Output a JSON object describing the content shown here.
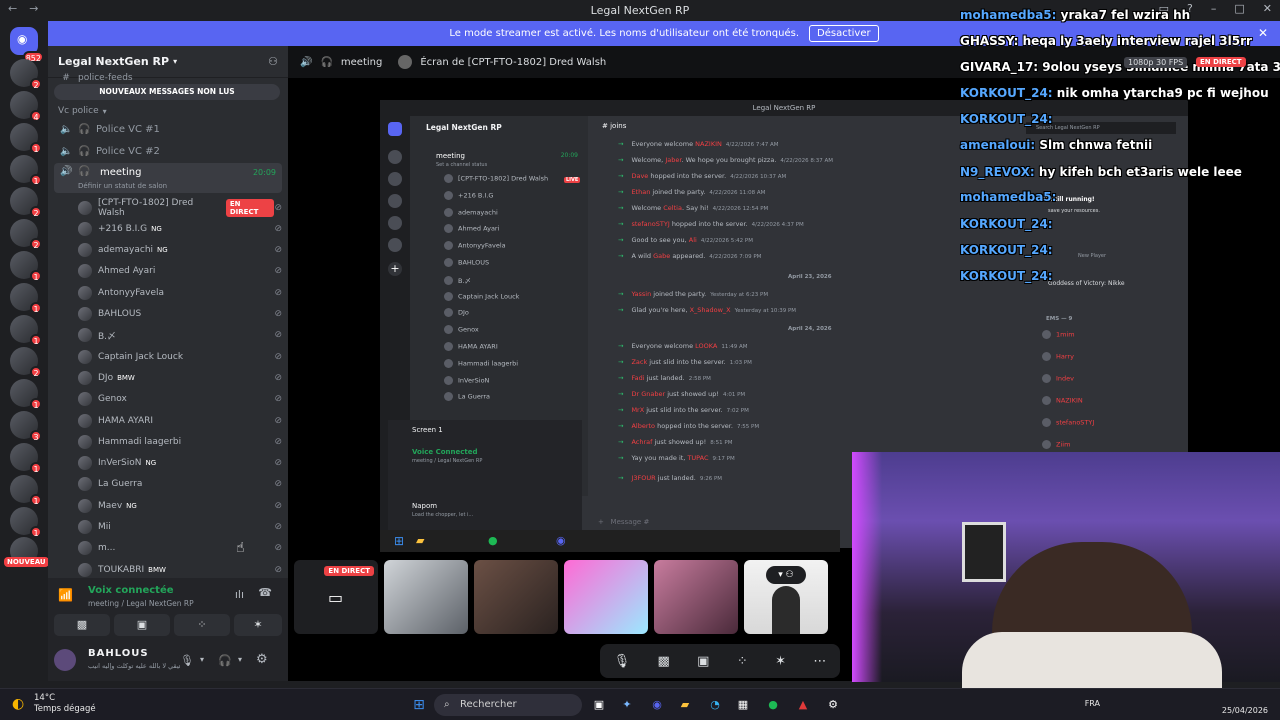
{
  "window": {
    "title": "Legal NextGen RP"
  },
  "banner": {
    "text": "Le mode streamer est activé. Les noms d'utilisateur ont été tronqués.",
    "button": "Désactiver"
  },
  "rail": {
    "home_badge": "852",
    "new_badge": "NOUVEAU",
    "badges": [
      "2",
      "4",
      "1",
      "1",
      "2",
      "2",
      "1",
      "1",
      "1",
      "2",
      "1",
      "3",
      "1",
      "1",
      "1",
      "1",
      "1",
      "2"
    ]
  },
  "sidebar": {
    "guild_name": "Legal NextGen RP",
    "partial_channel": "police-feeds",
    "new_messages": "NOUVEAUX MESSAGES NON LUS",
    "category": "Vc police",
    "channels": [
      "Police VC #1",
      "Police VC #2"
    ],
    "active_channel": {
      "name": "meeting",
      "time": "20:09",
      "status": "Définir un statut de salon"
    },
    "members": [
      {
        "name": "[CPT-FTO-1802] Dred Walsh",
        "tag": "",
        "live": "EN DIRECT"
      },
      {
        "name": "+216 B.I.G",
        "tag": "NG"
      },
      {
        "name": "ademayachi",
        "tag": "NG"
      },
      {
        "name": "Ahmed Ayari",
        "tag": ""
      },
      {
        "name": "AntonyyFavela",
        "tag": ""
      },
      {
        "name": "BAHLOUS",
        "tag": ""
      },
      {
        "name": "B.〆",
        "tag": ""
      },
      {
        "name": "Captain Jack Louck",
        "tag": ""
      },
      {
        "name": "DJo",
        "tag": "BMW"
      },
      {
        "name": "Genox",
        "tag": ""
      },
      {
        "name": "HAMA AYARI",
        "tag": ""
      },
      {
        "name": "Hammadi laagerbi",
        "tag": ""
      },
      {
        "name": "InVerSioN",
        "tag": "NG"
      },
      {
        "name": "La Guerra",
        "tag": ""
      },
      {
        "name": "Maev",
        "tag": "NG"
      },
      {
        "name": "Mii",
        "tag": ""
      },
      {
        "name": "m...",
        "tag": ""
      },
      {
        "name": "TOUKABRI",
        "tag": "BMW"
      }
    ],
    "voice": {
      "status": "Voix connectée",
      "location": "meeting / Legal NextGen RP"
    },
    "user": {
      "name": "BAHLOUS",
      "sub": "ربنا توفيقي لا بالله عليه توكلت وإليه انيب"
    }
  },
  "main": {
    "channel": "meeting",
    "screen": "Écran de [CPT-FTO-1802] Dred Walsh",
    "live_label": "EN DIRECT"
  },
  "share": {
    "title": "Legal NextGen RP",
    "guild": "Legal NextGen RP",
    "channel": "joins",
    "meeting": "meeting",
    "meeting_time": "20:09",
    "set_status": "Set a channel status",
    "members": [
      "[CPT-FTO-1802] Dred Walsh",
      "+216 B.I.G",
      "ademayachi",
      "Ahmed Ayari",
      "AntonyyFavela",
      "BAHLOUS",
      "B.〆",
      "Captain Jack Louck",
      "DJo",
      "Genox",
      "HAMA AYARI",
      "Hammadi laagerbi",
      "InVerSioN",
      "La Guerra"
    ],
    "live": "LIVE",
    "screen_label": "Screen 1",
    "voice_connected": "Voice Connected",
    "voice_loc": "meeting / Legal NextGen RP",
    "user": "Napom",
    "user_sub": "Load the chopper, let i...",
    "msg_placeholder": "Message #",
    "date1": "April 23, 2026",
    "date2": "April 24, 2026",
    "messages": [
      {
        "pre": "Everyone welcome ",
        "name": "NAZIKIN",
        "post": "",
        "time": "4/22/2026 7:47 AM"
      },
      {
        "pre": "Welcome, ",
        "name": "Jaber",
        "post": ". We hope you brought pizza.",
        "time": "4/22/2026 8:37 AM"
      },
      {
        "pre": "",
        "name": "Dave",
        "post": " hopped into the server.",
        "time": "4/22/2026 10:37 AM"
      },
      {
        "pre": "",
        "name": "Ethan",
        "post": " joined the party.",
        "time": "4/22/2026 11:08 AM"
      },
      {
        "pre": "Welcome ",
        "name": "Celtia",
        "post": ". Say hi!",
        "time": "4/22/2026 12:54 PM"
      },
      {
        "pre": "",
        "name": "stefanoSTYJ",
        "post": " hopped into the server.",
        "time": "4/22/2026 4:37 PM"
      },
      {
        "pre": "Good to see you, ",
        "name": "Ali",
        "post": "",
        "time": "4/22/2026 5:42 PM"
      },
      {
        "pre": "A wild ",
        "name": "Gabe",
        "post": " appeared.",
        "time": "4/22/2026 7:09 PM"
      },
      {
        "pre": "",
        "name": "Yassin",
        "post": " joined the party.",
        "time": "Yesterday at 6:23 PM"
      },
      {
        "pre": "Glad you're here, ",
        "name": "X_Shadow_X",
        "post": "",
        "time": "Yesterday at 10:39 PM"
      },
      {
        "pre": "Everyone welcome ",
        "name": "LOOKA",
        "post": "",
        "time": "11:49 AM"
      },
      {
        "pre": "",
        "name": "Zack",
        "post": " just slid into the server.",
        "time": "1:03 PM"
      },
      {
        "pre": "",
        "name": "Fadi",
        "post": " just landed.",
        "time": "2:58 PM"
      },
      {
        "pre": "",
        "name": "Dr Gnaber",
        "post": " just showed up!",
        "time": "4:01 PM"
      },
      {
        "pre": "",
        "name": "MrX",
        "post": " just slid into the server.",
        "time": "7:02 PM"
      },
      {
        "pre": "",
        "name": "Alberto",
        "post": " hopped into the server.",
        "time": "7:55 PM"
      },
      {
        "pre": "",
        "name": "Achraf",
        "post": " just showed up!",
        "time": "8:51 PM"
      },
      {
        "pre": "Yay you made it, ",
        "name": "TUPAC",
        "post": "",
        "time": "9:17 PM"
      },
      {
        "pre": "",
        "name": "J3FOUR",
        "post": " just landed.",
        "time": "9:26 PM"
      }
    ],
    "search": "Search Legal NextGen RP",
    "notif1": "Your stream is still running!",
    "notif2": "save your resources.",
    "game": "Goddess of Victory: Nikke",
    "game_sub": "New Player",
    "ems_header": "EMS — 9",
    "right_members": [
      "1mim",
      "Harry",
      "Indev",
      "NAZIKIN",
      "stefanoSTYJ",
      "Ziim"
    ]
  },
  "chat_overlay": [
    {
      "user": "mohamedba5:",
      "msg": "yraka7 fel wzira hh"
    },
    {
      "user": "GHASSY:",
      "msg": "heqa ly 3aely interview rajel 3l5rr"
    },
    {
      "user": "GIVARA_17:",
      "msg": "9olou yseys 3linamee mmna 7ata 3asba"
    },
    {
      "user": "KORKOUT_24:",
      "msg": "nik omha ytarcha9 pc fi wejhou"
    },
    {
      "user": "KORKOUT_24:",
      "msg": ""
    },
    {
      "user": "amenaloui:",
      "msg": "Slm chnwa fetnii"
    },
    {
      "user": "N9_REVOX:",
      "msg": "hy kifeh bch et3aris wele leee"
    },
    {
      "user": "mohamedba5:",
      "msg": ""
    },
    {
      "user": "KORKOUT_24:",
      "msg": ""
    },
    {
      "user": "KORKOUT_24:",
      "msg": ""
    },
    {
      "user": "KORKOUT_24:",
      "msg": ""
    }
  ],
  "stream_meta": {
    "fps": "1080p 30 FPS",
    "live": "EN DIRECT"
  },
  "taskbar": {
    "temp": "14°C",
    "weather": "Temps dégagé",
    "search": "Rechercher",
    "lang": "FRA",
    "date": "25/04/2026"
  },
  "colors": {
    "blurple": "#5865f2",
    "live_red": "#ed4245",
    "online_green": "#23a55a",
    "chat_blue": "#56a8ff"
  }
}
